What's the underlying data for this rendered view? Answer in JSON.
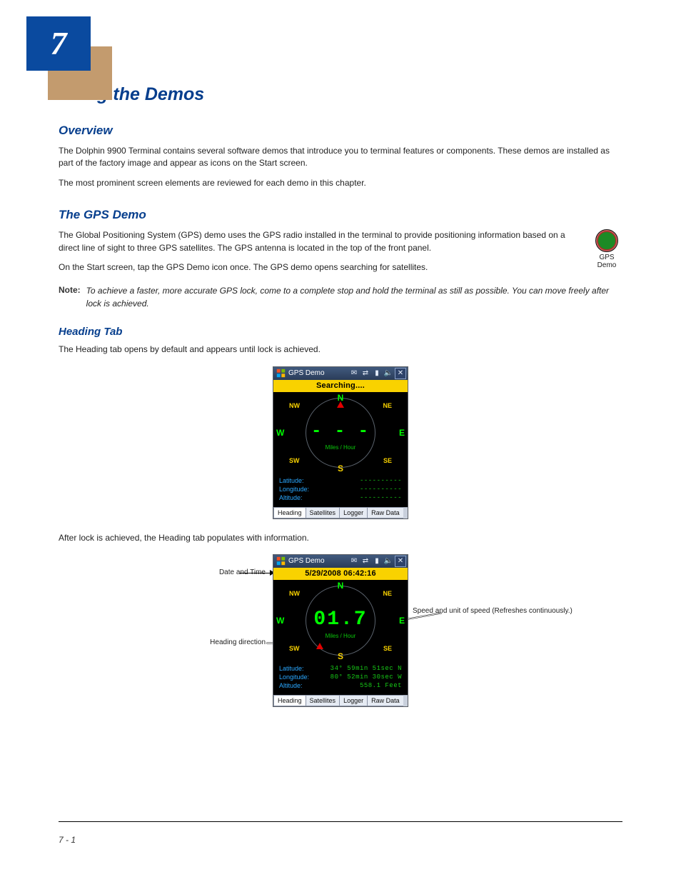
{
  "chapter_number": "7",
  "h1": "Using the Demos",
  "h2_overview": "Overview",
  "p_overview_1": "The Dolphin 9900 Terminal contains several software demos that introduce you to terminal features or components. These demos are installed as part of the factory image and appear as icons on the Start screen.",
  "p_overview_2": "The most prominent screen elements are reviewed for each demo in this chapter.",
  "h2_gps": "The GPS Demo",
  "app_icon_label": "GPS Demo",
  "p_gps_1": "The Global Positioning System (GPS) demo uses the GPS radio installed in the terminal to provide positioning information based on a direct line of sight to three GPS satellites. The GPS antenna is located in the top of the front panel.",
  "p_gps_2": "On the Start screen, tap the GPS Demo icon once. The GPS demo opens searching for satellites.",
  "note_label": "Note:",
  "p_gps_note": "To achieve a faster, more accurate GPS lock, come to a complete stop and hold the terminal as still as possible. You can move freely after lock is achieved.",
  "h3_heading_tab": "Heading Tab",
  "p_heading_tab": "The Heading tab opens by default and appears until lock is achieved.",
  "screen1": {
    "titlebar_text": "GPS Demo",
    "yellow_text": "Searching....",
    "speed": "- - -",
    "speed_unit": "Miles / Hour",
    "lbl_lat": "Latitude:",
    "val_lat": "----------",
    "lbl_lon": "Longitude:",
    "val_lon": "----------",
    "lbl_alt": "Altitude:",
    "val_alt": "----------",
    "tab_heading": "Heading",
    "tab_sat": "Satellites",
    "tab_log": "Logger",
    "tab_raw": "Raw Data",
    "dir_N": "N",
    "dir_NE": "NE",
    "dir_E": "E",
    "dir_SE": "SE",
    "dir_S": "S",
    "dir_SW": "SW",
    "dir_W": "W",
    "dir_NW": "NW"
  },
  "p_after_lock": "After lock is achieved, the Heading tab populates with information.",
  "screen2": {
    "titlebar_text": "GPS Demo",
    "yellow_text": "5/29/2008 06:42:16",
    "speed": "01.7",
    "speed_unit": "Miles / Hour",
    "lbl_lat": "Latitude:",
    "val_lat": "34° 59min 51sec N",
    "lbl_lon": "Longitude:",
    "val_lon": "80° 52min 30sec W",
    "lbl_alt": "Altitude:",
    "val_alt": "558.1 Feet",
    "tab_heading": "Heading",
    "tab_sat": "Satellites",
    "tab_log": "Logger",
    "tab_raw": "Raw Data",
    "dir_N": "N",
    "dir_NE": "NE",
    "dir_E": "E",
    "dir_SE": "SE",
    "dir_S": "S",
    "dir_SW": "SW",
    "dir_W": "W",
    "dir_NW": "NW"
  },
  "annotations": {
    "datetime": "Date and Time",
    "unit_speed": "Speed and unit of speed (Refreshes continuously.)",
    "heading_dir": "Heading direction"
  },
  "page_number": "7 - 1"
}
